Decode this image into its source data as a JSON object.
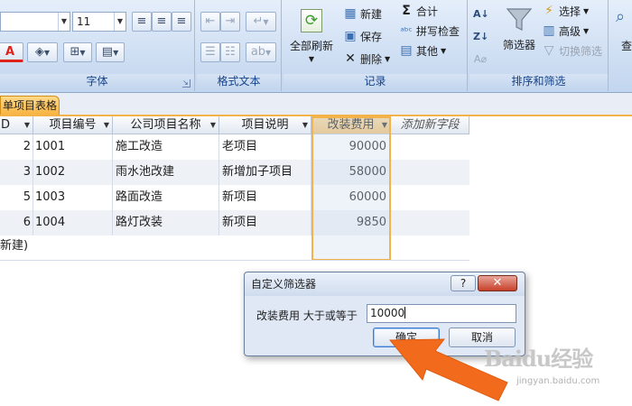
{
  "ribbon": {
    "font_group": {
      "label": "字体",
      "font_size": "11",
      "align_icons": [
        "align-left-icon",
        "align-center-icon",
        "align-right-icon"
      ],
      "font_color_glyph": "A",
      "font_color": "#e0231a"
    },
    "rich_text_group": {
      "label": "格式文本"
    },
    "records_group": {
      "label": "记录",
      "refresh_all": "全部刷新",
      "new": "新建",
      "save": "保存",
      "delete": "删除",
      "totals": "合计",
      "spelling": "拼写检查",
      "more": "其他"
    },
    "sort_filter_group": {
      "label": "排序和筛选",
      "filter": "筛选器",
      "selection": "选择",
      "advanced": "高级",
      "toggle_filter": "切换筛选"
    },
    "find_group": {
      "label": "查"
    }
  },
  "document_tab": {
    "label": "单项目表格"
  },
  "table": {
    "columns": [
      {
        "label": "D"
      },
      {
        "label": "项目编号"
      },
      {
        "label": "公司项目名称"
      },
      {
        "label": "项目说明"
      },
      {
        "label": "改装费用"
      },
      {
        "label": "添加新字段"
      }
    ],
    "rows": [
      {
        "id": "2",
        "code": "1001",
        "name": "施工改造",
        "desc": "老项目",
        "cost": "90000"
      },
      {
        "id": "3",
        "code": "1002",
        "name": "雨水池改建",
        "desc": "新增加子项目",
        "cost": "58000"
      },
      {
        "id": "5",
        "code": "1003",
        "name": "路面改造",
        "desc": "新项目",
        "cost": "60000"
      },
      {
        "id": "6",
        "code": "1004",
        "name": "路灯改装",
        "desc": "新项目",
        "cost": "9850"
      }
    ],
    "new_record": "新建)"
  },
  "dialog": {
    "title": "自定义筛选器",
    "help": "?",
    "close": "✕",
    "field_label": "改装费用 大于或等于",
    "value": "10000",
    "ok": "确定",
    "cancel": "取消"
  },
  "accent_colors": {
    "tab": "#f7b23e",
    "arrow": "#f26b1d",
    "close": "#c7402a"
  },
  "watermark": {
    "brand": "Baidu经验",
    "url": "jingyan.baidu.com"
  }
}
